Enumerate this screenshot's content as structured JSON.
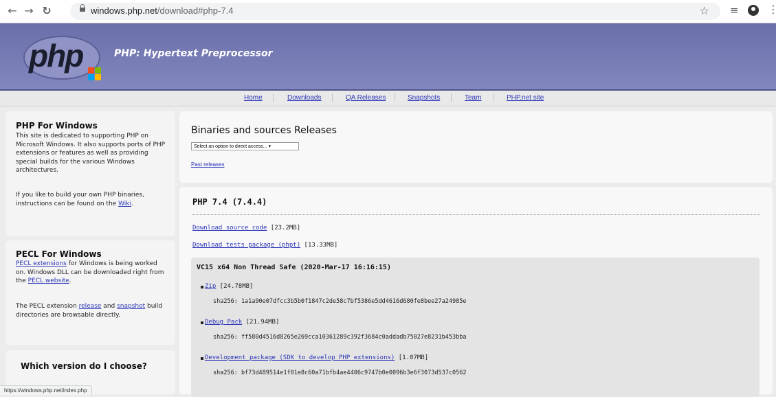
{
  "browser": {
    "url_host": "windows.php.net",
    "url_path": "/download#php-7.4",
    "status_url": "https://windows.php.net/index.php"
  },
  "header": {
    "logo_text": "php",
    "tagline": "PHP: Hypertext Preprocessor"
  },
  "menu": [
    "Home",
    "Downloads",
    "QA Releases",
    "Snapshots",
    "Team",
    "PHP.net site"
  ],
  "sidebar": {
    "php_windows": {
      "title": "PHP For Windows",
      "p1": "This site is dedicated to supporting PHP on Microsoft Windows. It also supports ports of PHP extensions or features as well as providing special builds for the various Windows architectures.",
      "p2_before": "If you like to build your own PHP binaries, instructions can be found on the ",
      "p2_link": "Wiki",
      "p2_after": "."
    },
    "pecl": {
      "title": "PECL For Windows",
      "p1_link1": "PECL extensions",
      "p1_mid": " for Windows is being worked on. Windows DLL can be downloaded right from the ",
      "p1_link2": "PECL website",
      "p1_end": ".",
      "p2_before": "The PECL extension ",
      "p2_link1": "release",
      "p2_mid": " and ",
      "p2_link2": "snapshot",
      "p2_after": " build directories are browsable directly."
    },
    "which": {
      "title": "Which version do I choose?"
    }
  },
  "releases": {
    "title": "Binaries and sources Releases",
    "select_value": "Select an option to direct access...",
    "past_releases": "Past releases"
  },
  "version": {
    "title": "PHP 7.4 (7.4.4)",
    "source_link": "Download source code",
    "source_size": " [23.2MB]",
    "tests_link": "Download tests package (phpt)",
    "tests_size": " [13.33MB]",
    "build": {
      "title": "VC15 x64 Non Thread Safe (2020-Mar-17 16:16:15)",
      "items": [
        {
          "link": "Zip",
          "size": " [24.78MB]",
          "sha": "sha256: 1a1a90e07dfcc3b5b0f1847c2de58c7bf5386e5dd4616d680fe8bee27a24985e"
        },
        {
          "link": "Debug Pack",
          "size": " [21.94MB]",
          "sha": "sha256: ff580d4516d8265e269cca10361289c392f3684c0addadb75027e8231b453bba"
        },
        {
          "link": "Development package (SDK to develop PHP extensions)",
          "size": " [1.07MB]",
          "sha": "sha256: bf73d489514e1f01e8c60a71bfb4ae4406c9747b0e0096b3e6f3073d537c0562"
        }
      ]
    }
  }
}
